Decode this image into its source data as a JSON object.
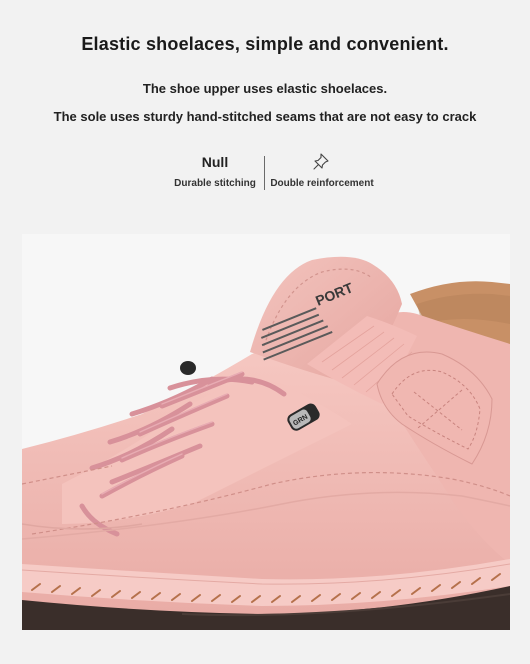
{
  "header": {
    "title": "Elastic shoelaces, simple and convenient.",
    "line1": "The shoe upper uses elastic shoelaces.",
    "line2": "The sole uses sturdy hand-stitched seams that are not easy to crack"
  },
  "features": [
    {
      "title": "Null",
      "label": "Durable stitching",
      "icon": null
    },
    {
      "title": "",
      "label": "Double reinforcement",
      "icon": "pushpin-icon"
    }
  ],
  "product_image": {
    "label_text": "PORT",
    "lace_stopper_text": "GRN",
    "colors": {
      "upper": "#f1b9b4",
      "upper_shadow": "#d99e99",
      "lace": "#d8919a",
      "sole": "#3a2e2a",
      "lining": "#c89066",
      "background": "#f7f7f7"
    }
  }
}
